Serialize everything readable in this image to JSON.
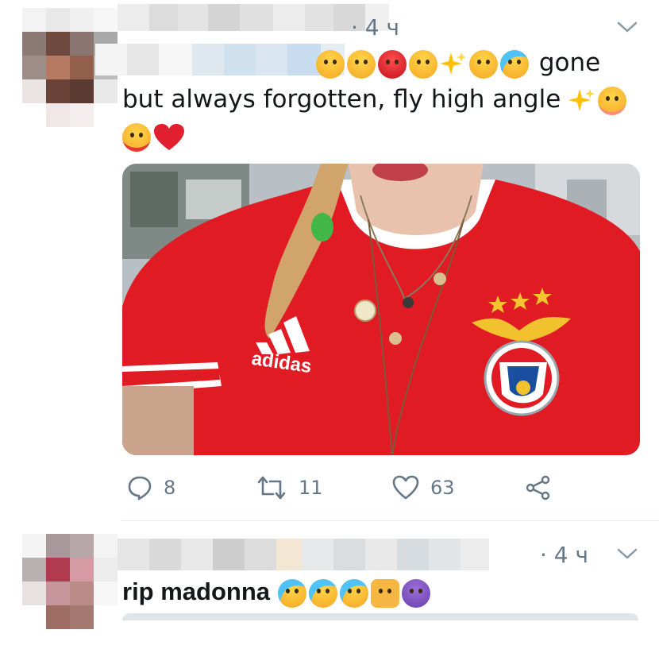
{
  "tweets": [
    {
      "time": "· 4 ч",
      "text_line1_suffix": "gone",
      "text_line2": "but always forgotten, fly high angle",
      "emojis_line1": [
        "anxious-sweat-face",
        "downcast-sweat-face",
        "angry-face",
        "sneezing-face",
        "sparkles",
        "steam-nose-face",
        "crying-face"
      ],
      "emojis_line2": [
        "sparkles",
        "smiling-blush-face"
      ],
      "emojis_line3": [
        "tongue-squint-face",
        "red-heart"
      ],
      "media": {
        "brand_logo_text": "adidas"
      },
      "actions": {
        "reply_count": "8",
        "retweet_count": "11",
        "like_count": "63"
      }
    },
    {
      "time": "· 4 ч",
      "text": "rip madonna",
      "emojis": [
        "crying-face",
        "crying-face",
        "crying-face",
        "fist",
        "angry-devil-face"
      ]
    }
  ],
  "colors": {
    "text": "#14171a",
    "muted": "#657786",
    "divider": "#e6ecf0",
    "shirt_red": "#e01b24",
    "heart_red": "#e0202e"
  }
}
